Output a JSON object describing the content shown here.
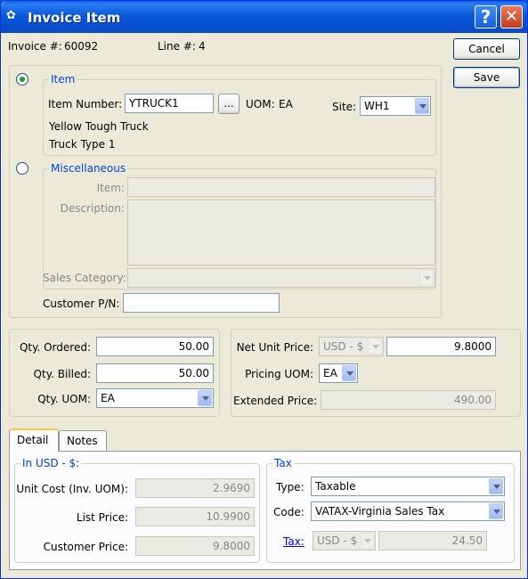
{
  "window": {
    "title": "Invoice Item"
  },
  "header": {
    "invoice_label": "Invoice #:",
    "invoice_value": "60092",
    "line_label": "Line #:",
    "line_value": "4"
  },
  "buttons": {
    "cancel": "Cancel",
    "save": "Save",
    "browse": "..."
  },
  "item_group": {
    "title": "Item",
    "item_number_label": "Item Number:",
    "item_number_value": "YTRUCK1",
    "uom_label": "UOM:",
    "uom_value": "EA",
    "site_label": "Site:",
    "site_value": "WH1",
    "description1": "Yellow Tough Truck",
    "description2": "Truck Type 1"
  },
  "misc_group": {
    "title": "Miscellaneous",
    "item_label": "Item:",
    "item_value": "",
    "description_label": "Description:",
    "sales_category_label": "Sales Category:",
    "sales_category_value": ""
  },
  "customer_pn": {
    "label": "Customer P/N:",
    "value": ""
  },
  "quantities": {
    "ordered_label": "Qty. Ordered:",
    "ordered_value": "50.00",
    "billed_label": "Qty. Billed:",
    "billed_value": "50.00",
    "uom_label": "Qty. UOM:",
    "uom_value": "EA"
  },
  "pricing": {
    "net_unit_price_label": "Net Unit Price:",
    "currency_value": "USD - $",
    "net_unit_price_value": "9.8000",
    "pricing_uom_label": "Pricing UOM:",
    "pricing_uom_value": "EA",
    "extended_price_label": "Extended Price:",
    "extended_price_value": "490.00"
  },
  "tabs": [
    {
      "label": "Detail"
    },
    {
      "label": "Notes"
    }
  ],
  "detail": {
    "currency_group_title": "In USD - $:",
    "unit_cost_label": "Unit Cost (Inv. UOM):",
    "unit_cost_value": "2.9690",
    "list_price_label": "List Price:",
    "list_price_value": "10.9900",
    "customer_price_label": "Customer Price:",
    "customer_price_value": "9.8000"
  },
  "tax": {
    "group_title": "Tax",
    "type_label": "Type:",
    "type_value": "Taxable",
    "code_label": "Code:",
    "code_value": "VATAX-Virginia Sales Tax",
    "tax_link": "Tax:",
    "tax_currency": "USD - $",
    "tax_value": "24.50"
  },
  "colors": {
    "titlebar": "#0a58d8",
    "window_bg": "#ece9d8",
    "group_title": "#0046d5"
  }
}
